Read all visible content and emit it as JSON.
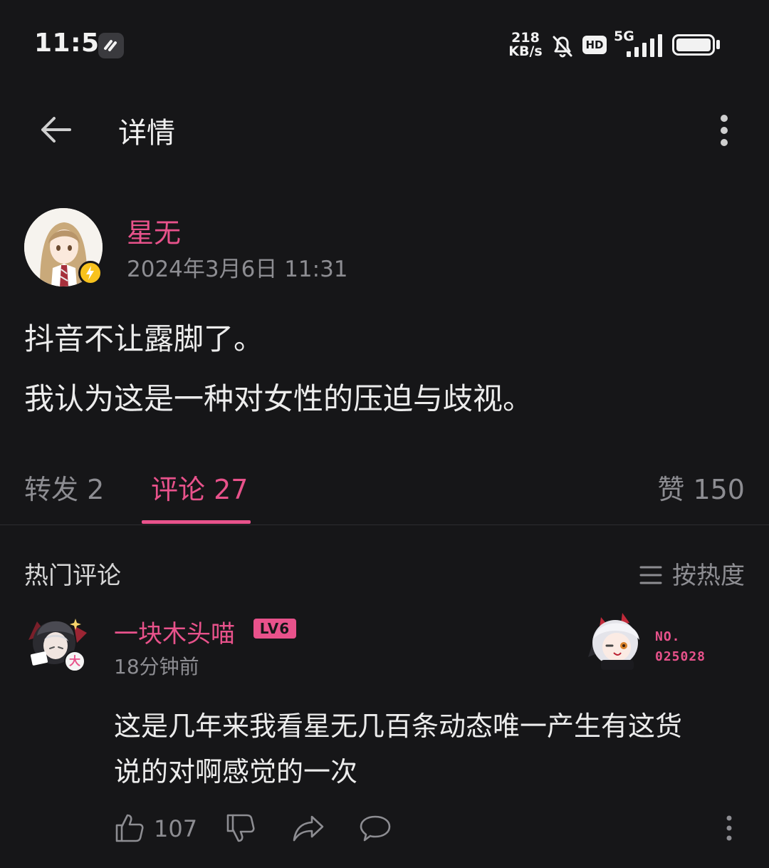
{
  "status_bar": {
    "time": "11:51",
    "net_speed_value": "218",
    "net_speed_unit": "KB/s",
    "hd": "HD",
    "network": "5G"
  },
  "header": {
    "title": "详情"
  },
  "post": {
    "author": "星无",
    "time": "2024年3月6日 11:31",
    "lines": [
      "抖音不让露脚了。",
      "我认为这是一种对女性的压迫与歧视。"
    ]
  },
  "tabs": {
    "repost": "转发 2",
    "comment": "评论 27",
    "like": "赞 150"
  },
  "comments_section": {
    "title": "热门评论",
    "sort_label": "按热度"
  },
  "comment": {
    "badge": "大",
    "user": "一块木头喵",
    "level": "LV6",
    "time": "18分钟前",
    "fan_label": "NO.",
    "fan_number": "025028",
    "lines": [
      "这是几年来我看星无几百条动态唯一产生有这货",
      "说的对啊感觉的一次"
    ],
    "like_count": "107"
  },
  "colors": {
    "background": "#161618",
    "accent": "#e8528b",
    "muted": "#8d8d92"
  }
}
